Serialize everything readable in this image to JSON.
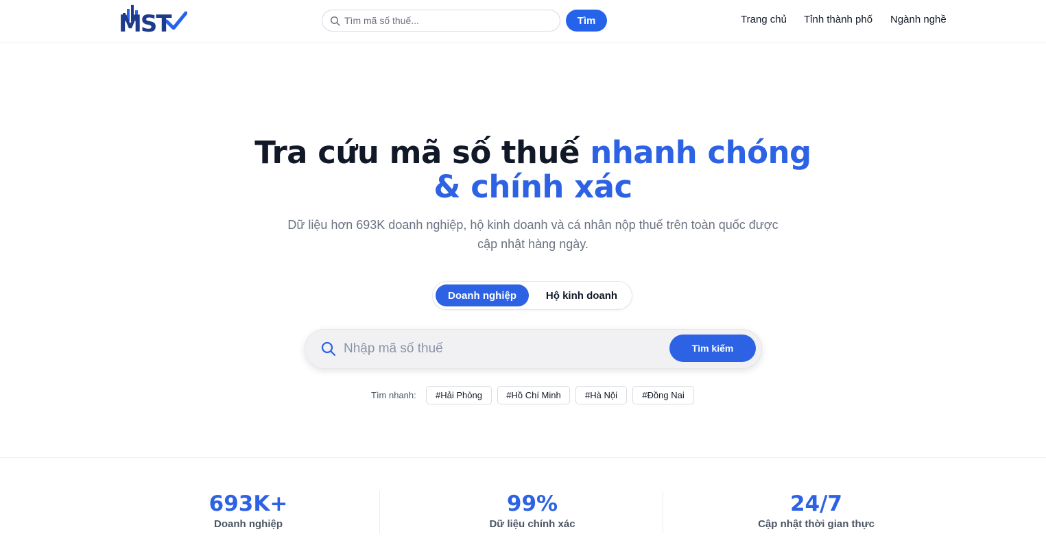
{
  "brand": {
    "logo_text": "MST"
  },
  "header": {
    "search_placeholder": "Tìm mã số thuế...",
    "search_button": "Tìm",
    "nav": [
      "Trang chủ",
      "Tỉnh thành phố",
      "Ngành nghề"
    ]
  },
  "hero": {
    "title_dark": "Tra cứu mã số thuế ",
    "title_accent": "nhanh chóng & chính xác",
    "subtitle_line1": "Dữ liệu hơn 693K doanh nghiệp, hộ kinh doanh và cá nhân nộp thuế trên toàn quốc được",
    "subtitle_line2": "cập nhật hàng ngày."
  },
  "toggle": {
    "active": "Doanh nghiệp",
    "inactive": "Hộ kinh doanh"
  },
  "search": {
    "placeholder": "Nhập mã số thuế",
    "button": "Tìm kiếm"
  },
  "quick": {
    "label": "Tìm nhanh:",
    "tags": [
      "#Hải Phòng",
      "#Hồ Chí Minh",
      "#Hà Nội",
      "#Đồng Nai"
    ]
  },
  "stats": [
    {
      "value": "693K+",
      "label": "Doanh nghiệp"
    },
    {
      "value": "99%",
      "label": "Dữ liệu chính xác"
    },
    {
      "value": "24/7",
      "label": "Cập nhật thời gian thực"
    }
  ],
  "colors": {
    "accent": "#2c62e3",
    "navy": "#1e3a8a"
  }
}
